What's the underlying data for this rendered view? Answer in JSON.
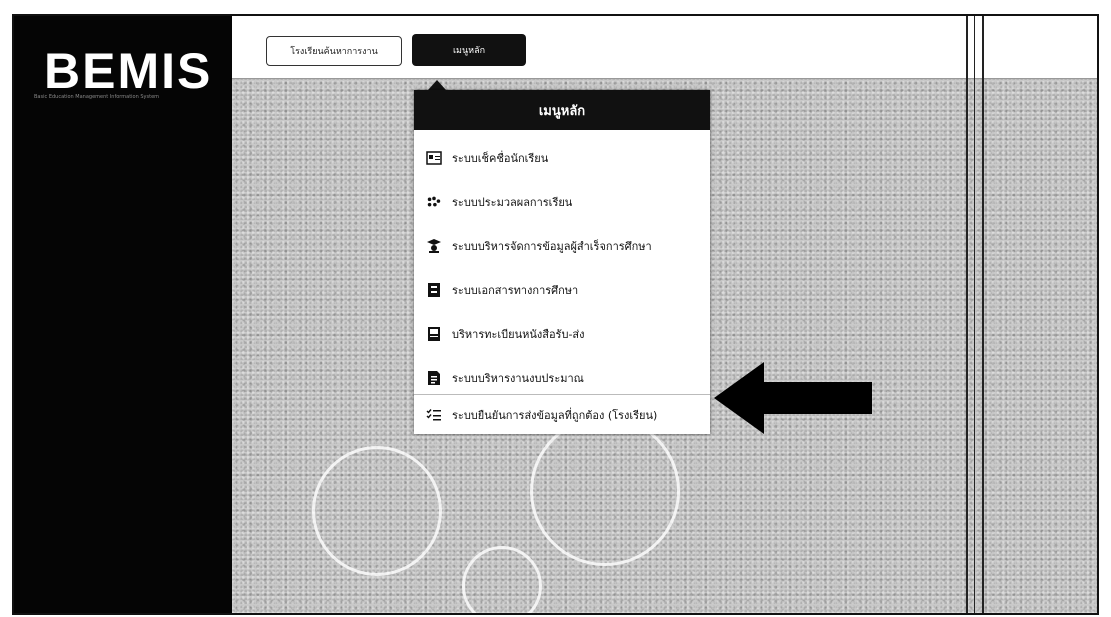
{
  "sidebar": {
    "logo": "BEMIS",
    "logo_subtitle": "Basic Education Management Information System"
  },
  "topbar": {
    "school_button_label": "โรงเรียนค้นหาการงาน",
    "main_menu_button_label": "เมนูหลัก"
  },
  "menu": {
    "title": "เมนูหลัก",
    "items": [
      {
        "label": "ระบบเช็คชื่อนักเรียน",
        "icon": "id-card-icon"
      },
      {
        "label": "ระบบประมวลผลการเรียน",
        "icon": "users-icon"
      },
      {
        "label": "ระบบบริหารจัดการข้อมูลผู้สำเร็จการศึกษา",
        "icon": "graduate-icon"
      },
      {
        "label": "ระบบเอกสารทางการศึกษา",
        "icon": "book-icon"
      },
      {
        "label": "บริหารทะเบียนหนังสือรับ-ส่ง",
        "icon": "inbox-icon"
      },
      {
        "label": "ระบบบริหารงานงบประมาณ",
        "icon": "budget-icon"
      },
      {
        "label": "ระบบยืนยันการส่งข้อมูลที่ถูกต้อง (โรงเรียน)",
        "icon": "checklist-icon"
      }
    ]
  },
  "colors": {
    "sidebar": "#050505",
    "menu_header": "#111111",
    "arrow": "#000000"
  }
}
